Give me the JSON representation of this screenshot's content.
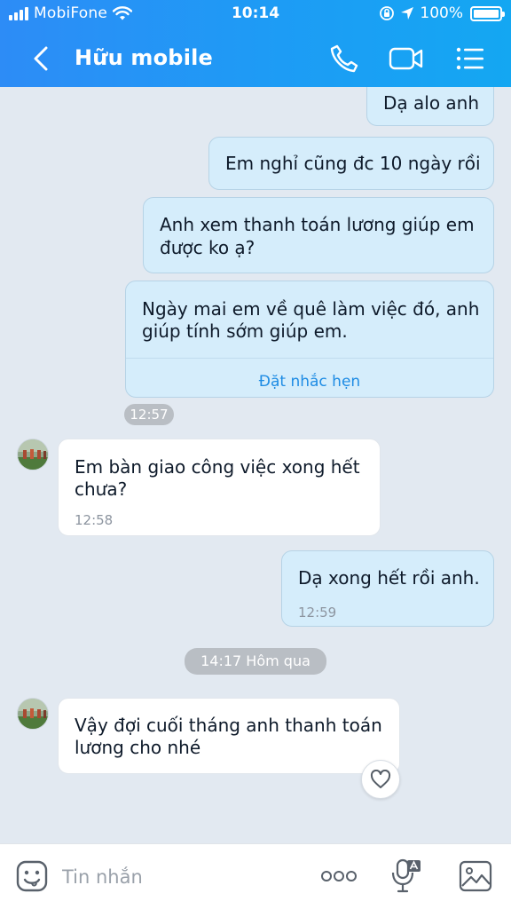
{
  "status_bar": {
    "carrier": "MobiFone",
    "time": "10:14",
    "battery": "100%"
  },
  "header": {
    "title": "Hữu mobile",
    "icons": [
      "back-chevron-icon",
      "phone-icon",
      "video-call-icon",
      "menu-list-icon"
    ]
  },
  "messages": {
    "m1": {
      "text": "Dạ alo anh"
    },
    "m2": {
      "text": "Em nghỉ cũng đc 10 ngày rồi"
    },
    "m3": {
      "line1": "Anh xem thanh toán lương giúp em",
      "line2": "được ko ạ?"
    },
    "m4": {
      "line1": "Ngày mai em về quê làm việc đó, anh",
      "line2": "giúp tính sớm giúp em.",
      "action": "Đặt nhắc hẹn"
    },
    "t1": "12:57",
    "m5": {
      "line1": "Em bàn giao công việc xong hết",
      "line2": "chưa?",
      "time": "12:58"
    },
    "m6": {
      "text": "Dạ xong hết rồi anh.",
      "time": "12:59"
    },
    "divider": "14:17 Hôm qua",
    "m7": {
      "line1": "Vậy đợi cuối tháng anh thanh toán",
      "line2": "lương cho nhé"
    }
  },
  "input_bar": {
    "placeholder": "Tin nhắn",
    "icons": [
      "sticker-icon",
      "more-icon",
      "voice-to-text-icon",
      "image-icon"
    ]
  },
  "colors": {
    "header": "#1d9cf5",
    "chat_background": "#e2e9f1",
    "outgoing_bubble": "#d5edfb",
    "incoming_bubble": "#ffffff",
    "link": "#1e8ce4"
  }
}
